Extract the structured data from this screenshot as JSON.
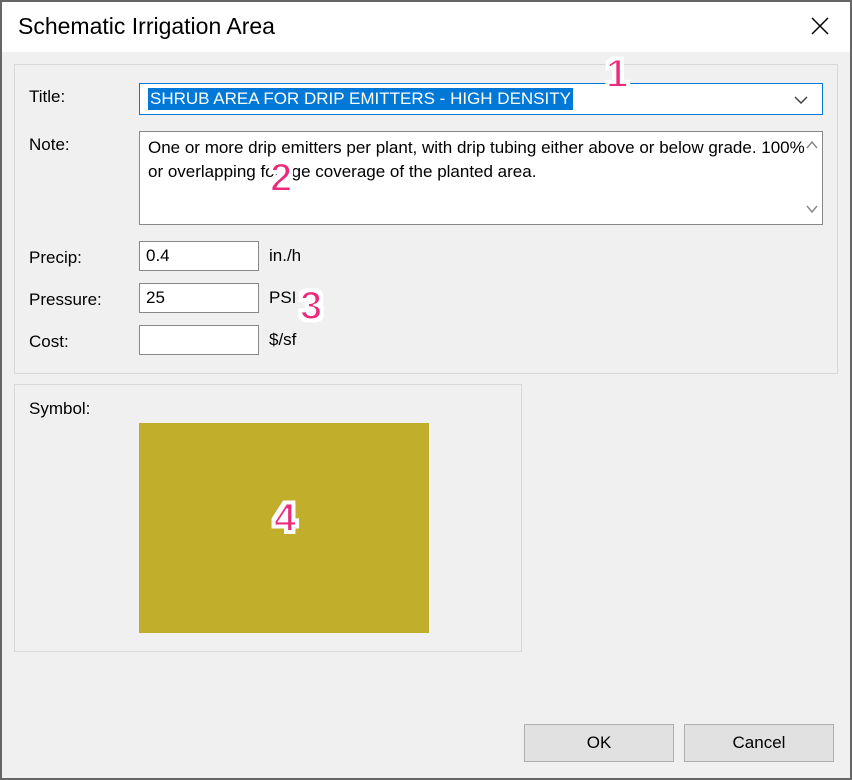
{
  "window": {
    "title": "Schematic Irrigation Area"
  },
  "form": {
    "title_label": "Title:",
    "title_value": "SHRUB AREA FOR DRIP EMITTERS - HIGH DENSITY",
    "note_label": "Note:",
    "note_value": "One or more drip emitters per plant, with drip tubing either above or below grade.  100% or overlapping foliage coverage of the planted area.",
    "precip_label": "Precip:",
    "precip_value": "0.4",
    "precip_unit": "in./h",
    "pressure_label": "Pressure:",
    "pressure_value": "25",
    "pressure_unit": "PSI",
    "cost_label": "Cost:",
    "cost_value": "",
    "cost_unit": "$/sf",
    "symbol_label": "Symbol:",
    "symbol_color": "#c1ae2a"
  },
  "buttons": {
    "ok": "OK",
    "cancel": "Cancel"
  },
  "annotations": {
    "a1": "1",
    "a2": "2",
    "a3": "3",
    "a4": "4"
  }
}
